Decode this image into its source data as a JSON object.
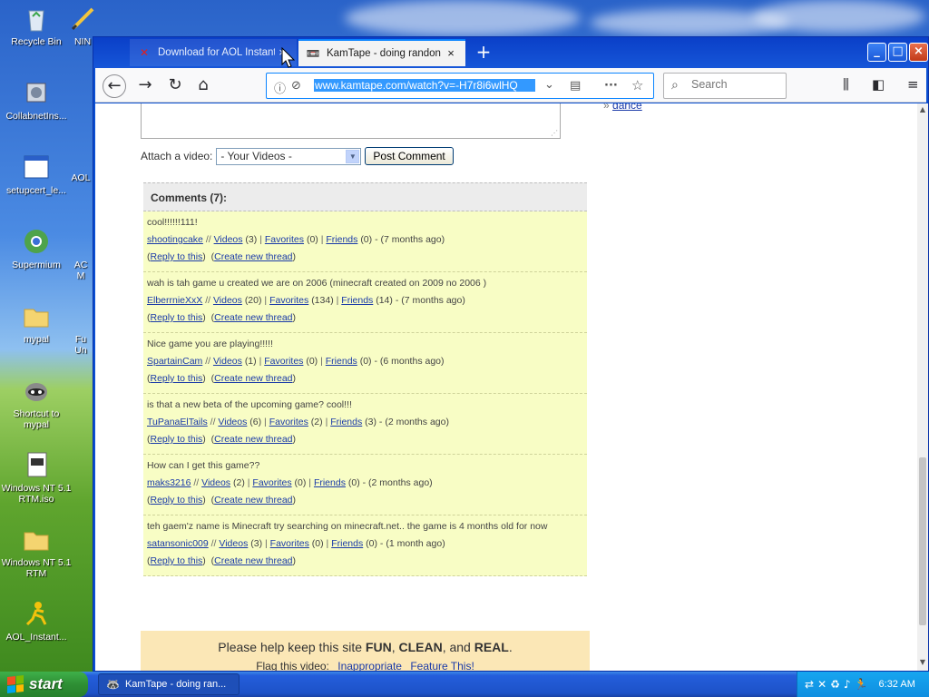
{
  "desktop": {
    "icons": [
      {
        "label": "Recycle Bin"
      },
      {
        "label": "NIN"
      },
      {
        "label": "CollabnetIns..."
      },
      {
        "label": "setupcert_le..."
      },
      {
        "label": "AOL"
      },
      {
        "label": "Supermium"
      },
      {
        "label": "AC M"
      },
      {
        "label": "mypal"
      },
      {
        "label": "Fu Un"
      },
      {
        "label": "Shortcut to mypal"
      },
      {
        "label": "Windows NT 5.1 RTM.iso"
      },
      {
        "label": "Windows NT 5.1 RTM"
      },
      {
        "label": "AOL_Instant..."
      }
    ]
  },
  "browser": {
    "tabs": [
      {
        "title": "Download for AOL Instant",
        "close": "×"
      },
      {
        "title": "KamTape - doing randon o",
        "close": "×"
      }
    ],
    "new_tab": "+",
    "url": "www.kamtape.com/watch?v=-H7r8i6wlHQ",
    "search_placeholder": "Search",
    "window_buttons": {
      "minimize": "_",
      "maximize": "□",
      "close": "×"
    }
  },
  "page": {
    "sidebar_link_prefix": "»",
    "sidebar_link": "dance",
    "attach_label": "Attach a video:",
    "attach_selected": "- Your Videos -",
    "post_button": "Post Comment",
    "comments_header": "Comments (7):",
    "comments": [
      {
        "text": "cool!!!!!!111!",
        "user": "shootingcake",
        "videos_label": "Videos",
        "videos_count": "(3)",
        "favorites_label": "Favorites",
        "favorites_count": "(0)",
        "friends_label": "Friends",
        "friends_count": "(0)",
        "age": "- (7 months ago)",
        "reply": "Reply to this",
        "new_thread": "Create new thread"
      },
      {
        "text": "wah is tah game u created we are on 2006 (minecraft created on 2009 no 2006 )",
        "user": "ElberrnieXxX",
        "videos_label": "Videos",
        "videos_count": "(20)",
        "favorites_label": "Favorites",
        "favorites_count": "(134)",
        "friends_label": "Friends",
        "friends_count": "(14)",
        "age": "- (7 months ago)",
        "reply": "Reply to this",
        "new_thread": "Create new thread"
      },
      {
        "text": "Nice game you are playing!!!!!",
        "user": "SpartainCam",
        "videos_label": "Videos",
        "videos_count": "(1)",
        "favorites_label": "Favorites",
        "favorites_count": "(0)",
        "friends_label": "Friends",
        "friends_count": "(0)",
        "age": "- (6 months ago)",
        "reply": "Reply to this",
        "new_thread": "Create new thread"
      },
      {
        "text": "is that a new beta of the upcoming game? cool!!!",
        "user": "TuPanaElTails",
        "videos_label": "Videos",
        "videos_count": "(6)",
        "favorites_label": "Favorites",
        "favorites_count": "(2)",
        "friends_label": "Friends",
        "friends_count": "(3)",
        "age": "- (2 months ago)",
        "reply": "Reply to this",
        "new_thread": "Create new thread"
      },
      {
        "text": "How can I get this game??",
        "user": "maks3216",
        "videos_label": "Videos",
        "videos_count": "(2)",
        "favorites_label": "Favorites",
        "favorites_count": "(0)",
        "friends_label": "Friends",
        "friends_count": "(0)",
        "age": "- (2 months ago)",
        "reply": "Reply to this",
        "new_thread": "Create new thread"
      },
      {
        "text": "teh gaem'z name is Minecraft try searching on minecraft.net.. the game is 4 months old for now",
        "user": "satansonic009",
        "videos_label": "Videos",
        "videos_count": "(3)",
        "favorites_label": "Favorites",
        "favorites_count": "(0)",
        "friends_label": "Friends",
        "friends_count": "(0)",
        "age": "- (1 month ago)",
        "reply": "Reply to this",
        "new_thread": "Create new thread"
      }
    ],
    "notice_pre": "Please help keep this site",
    "notice_fun": "FUN",
    "notice_clean": "CLEAN",
    "notice_and": ", and",
    "notice_real": "REAL",
    "notice_end": ".",
    "flag_label": "Flag this video:",
    "flag_inappropriate": "Inappropriate",
    "flag_feature": "Feature This!"
  },
  "taskbar": {
    "start": "start",
    "task_item": "KamTape - doing ran...",
    "clock": "6:32 AM"
  },
  "colors": {
    "comment_bg": "#f8fdc5",
    "notice_bg": "#fbe7b6",
    "link": "#1a3aa8",
    "url_highlight": "#3399ff",
    "start_green": "#2e8f34",
    "taskbar_blue": "#245edb"
  }
}
